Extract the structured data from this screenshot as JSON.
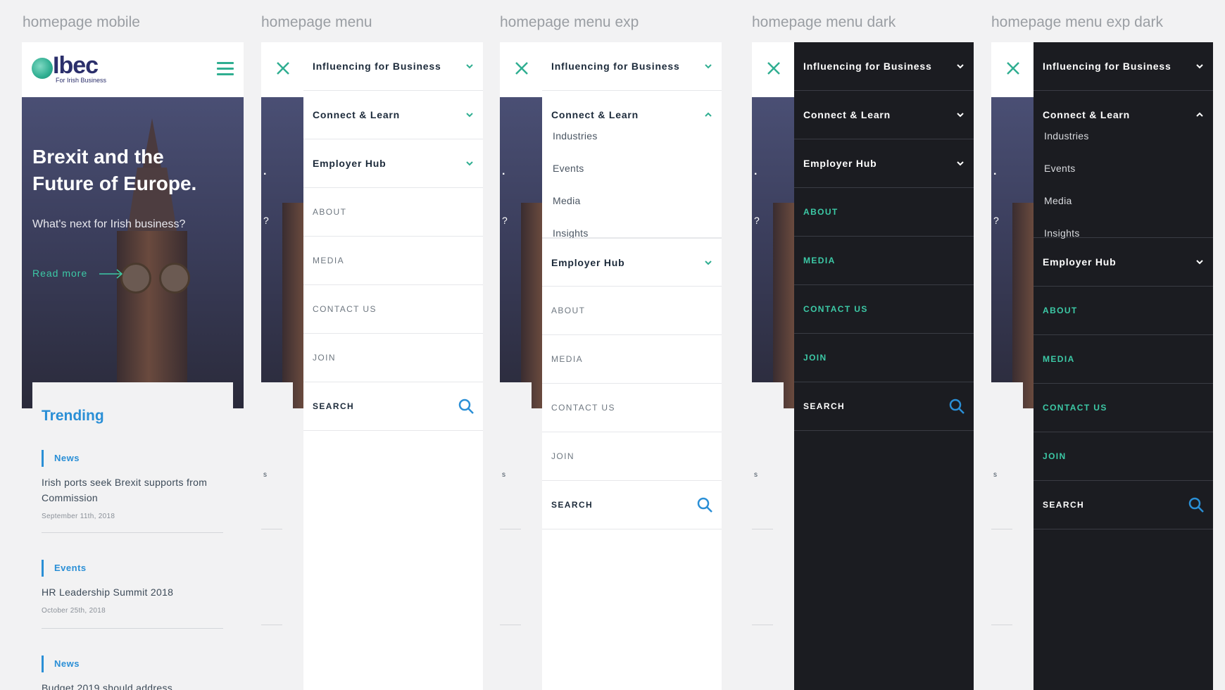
{
  "artboards": {
    "mobile": "homepage mobile",
    "menu": "homepage menu",
    "menu_exp": "homepage menu exp",
    "menu_dark": "homepage menu dark",
    "menu_exp_dark": "homepage menu exp dark"
  },
  "logo": {
    "word": "Ibec",
    "tagline": "For Irish Business"
  },
  "hero": {
    "title": "Brexit and the Future of Europe.",
    "subtitle": "What's next for Irish business?",
    "link": "Read more"
  },
  "trending": {
    "title": "Trending",
    "items": [
      {
        "category": "News",
        "headline": "Irish ports seek Brexit supports from Commission",
        "date": "September 11th, 2018"
      },
      {
        "category": "Events",
        "headline": "HR Leadership Summit 2018",
        "date": "October 25th, 2018"
      },
      {
        "category": "News",
        "headline": "Budget 2019 should address",
        "date": ""
      }
    ]
  },
  "menu": {
    "influencing": "Influencing for Business",
    "connect": "Connect & Learn",
    "employer": "Employer Hub",
    "about": "ABOUT",
    "media": "MEDIA",
    "contact": "CONTACT US",
    "join": "JOIN",
    "search": "SEARCH",
    "connect_sub": [
      "Industries",
      "Events",
      "Media",
      "Insights"
    ]
  },
  "strip_chars": {
    "s": "s",
    "q": "?",
    "dot": "."
  },
  "colors": {
    "accent_green": "#2fae91",
    "link_teal": "#3cc9a6",
    "trending_blue": "#2a8fd6",
    "dark_panel": "#1b1c21",
    "logo_navy": "#2b2f6b"
  },
  "icons": [
    "menu-icon",
    "close-icon",
    "chevron-down-icon",
    "chevron-up-icon",
    "search-icon",
    "arrow-right-icon"
  ]
}
